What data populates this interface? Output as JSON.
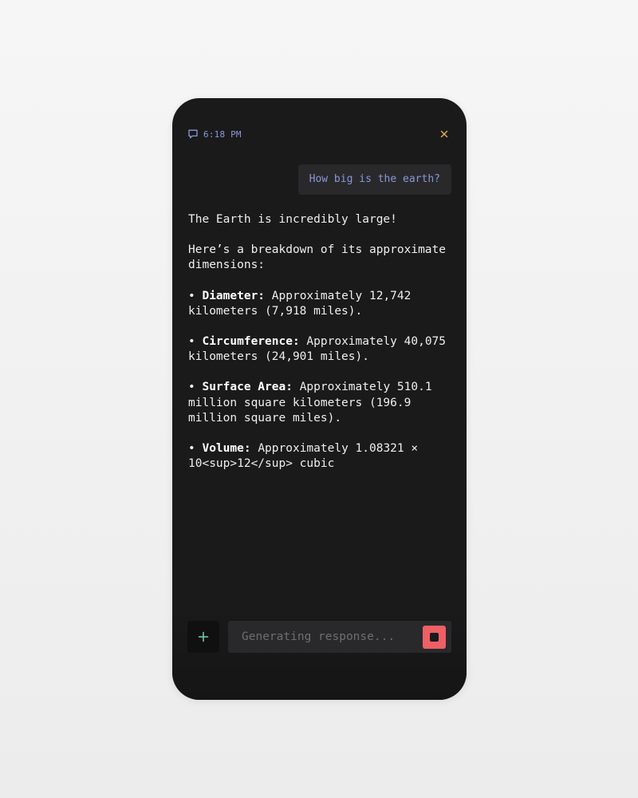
{
  "header": {
    "time": "6:18 PM"
  },
  "conversation": {
    "user_message": "How big is the earth?",
    "assistant": {
      "intro": "The Earth is incredibly large!",
      "lead": "Here’s a breakdown of its approximate dimensions:",
      "bullets": [
        {
          "label": "Diameter:",
          "text": "Approximately 12,742 kilometers (7,918 miles)."
        },
        {
          "label": "Circumference:",
          "text": "Approximately 40,075 kilometers (24,901 miles)."
        },
        {
          "label": "Surface Area:",
          "text": "Approximately 510.1 million square kilometers (196.9 million square miles)."
        },
        {
          "label": "Volume:",
          "text": "Approximately 1.08321 × 10<sup>12</sup> cubic"
        }
      ]
    }
  },
  "composer": {
    "placeholder": "Generating response..."
  },
  "icons": {
    "chat": "chat-bubble-icon",
    "close": "close-icon",
    "add": "plus-icon",
    "stop": "stop-icon"
  },
  "colors": {
    "accent_blue": "#8c96d8",
    "close_orange": "#e6b157",
    "plus_teal": "#6fd4b4",
    "stop_red": "#ee5f66"
  }
}
